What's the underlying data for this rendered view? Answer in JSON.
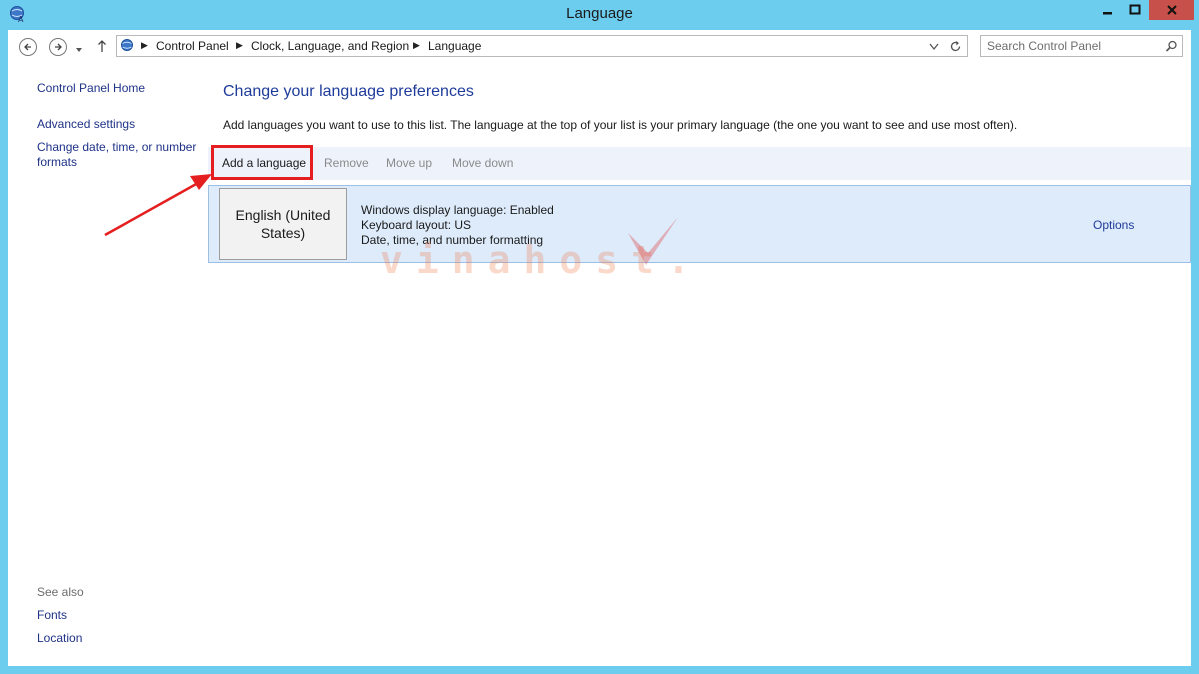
{
  "window": {
    "title": "Language",
    "minimize_icon": "minimize-icon",
    "maximize_icon": "maximize-icon",
    "close_icon": "close-icon"
  },
  "address_bar": {
    "breadcrumbs": [
      "Control Panel",
      "Clock, Language, and Region",
      "Language"
    ],
    "search_placeholder": "Search Control Panel"
  },
  "sidebar": {
    "home": "Control Panel Home",
    "advanced": "Advanced settings",
    "change_date_line1": "Change date, time, or number",
    "change_date_line2": "formats",
    "see_also": "See also",
    "fonts": "Fonts",
    "location": "Location"
  },
  "main": {
    "heading": "Change your language preferences",
    "description": "Add languages you want to use to this list. The language at the top of your list is your primary language (the one you want to see and use most often).",
    "toolbar": {
      "add": "Add a language",
      "remove": "Remove",
      "move_up": "Move up",
      "move_down": "Move down"
    },
    "languages": [
      {
        "name": "English (United States)",
        "display": "Windows display language: Enabled",
        "keyboard": "Keyboard layout: US",
        "formatting": "Date, time, and number formatting",
        "options": "Options"
      }
    ]
  },
  "watermark": "vinahost.vn",
  "colors": {
    "titlebar": "#6ccdef",
    "close_button": "#c7504a",
    "link": "#1e3287",
    "highlight": "#e51f1f",
    "selected_row": "#ddebfb"
  }
}
